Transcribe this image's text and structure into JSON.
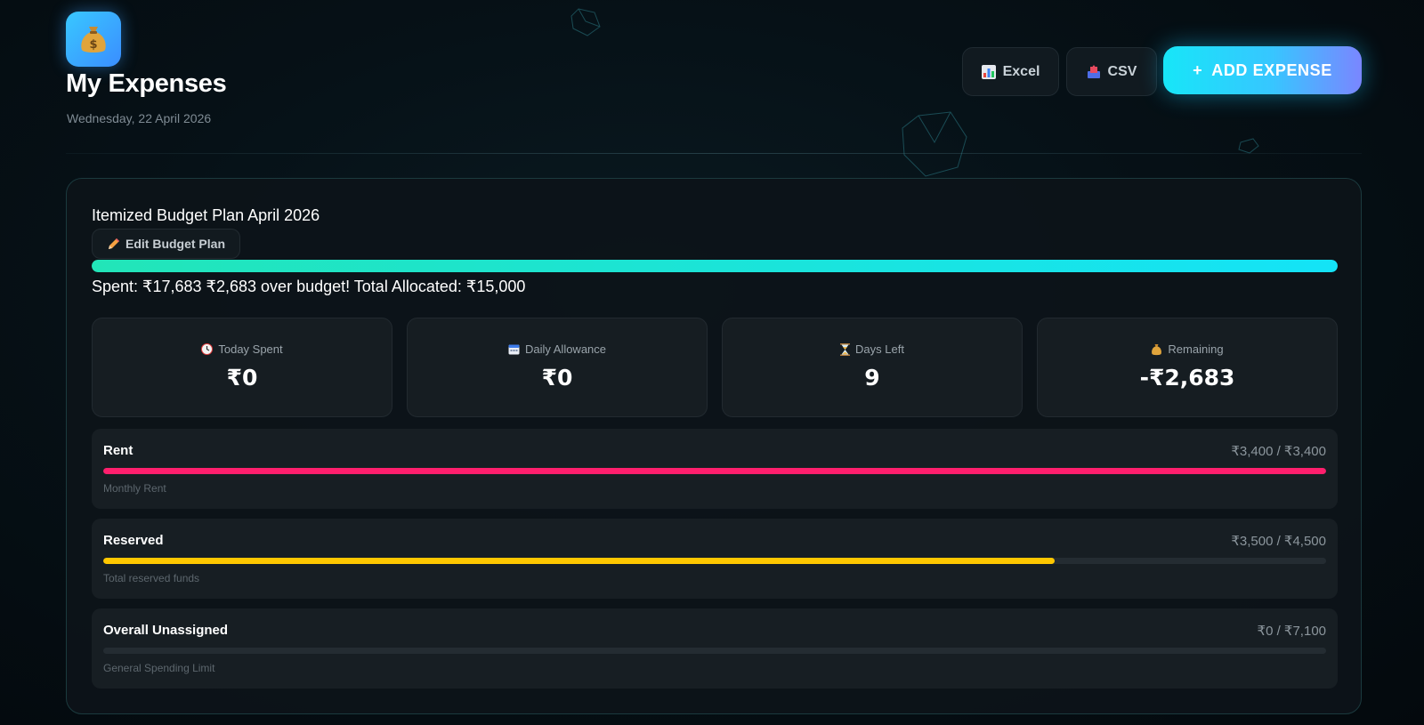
{
  "header": {
    "app_icon": "money-bag-icon",
    "title": "My Expenses",
    "date": "Wednesday, 22 April 2026",
    "excel_label": "Excel",
    "csv_label": "CSV",
    "add_label": "ADD EXPENSE",
    "add_prefix": "+"
  },
  "budget": {
    "title": "Itemized Budget Plan April 2026",
    "edit_label": "Edit Budget Plan",
    "overall_progress": 1.0,
    "summary": "Spent: ₹17,683 ₹2,683 over budget! Total Allocated: ₹15,000"
  },
  "stats": [
    {
      "icon": "clock-icon",
      "label": "Today Spent",
      "value": "₹0"
    },
    {
      "icon": "calendar-icon",
      "label": "Daily Allowance",
      "value": "₹0"
    },
    {
      "icon": "hourglass-icon",
      "label": "Days Left",
      "value": "9"
    },
    {
      "icon": "money-bag-icon",
      "label": "Remaining",
      "value": "-₹2,683"
    }
  ],
  "categories": [
    {
      "name": "Rent",
      "amount": "₹3,400 / ₹3,400",
      "description": "Monthly Rent",
      "progress": 1.0,
      "color": "#ff1f6d"
    },
    {
      "name": "Reserved",
      "amount": "₹3,500 / ₹4,500",
      "description": "Total reserved funds",
      "progress": 0.778,
      "color": "#ffc700"
    },
    {
      "name": "Overall Unassigned",
      "amount": "₹0 / ₹7,100",
      "description": "General Spending Limit",
      "progress": 0.0,
      "color": "#2f3a41"
    }
  ],
  "colors": {
    "accent_cyan": "#14e3f7",
    "accent_teal": "#22e5b8",
    "rent": "#ff1f6d",
    "reserved": "#ffc700"
  }
}
